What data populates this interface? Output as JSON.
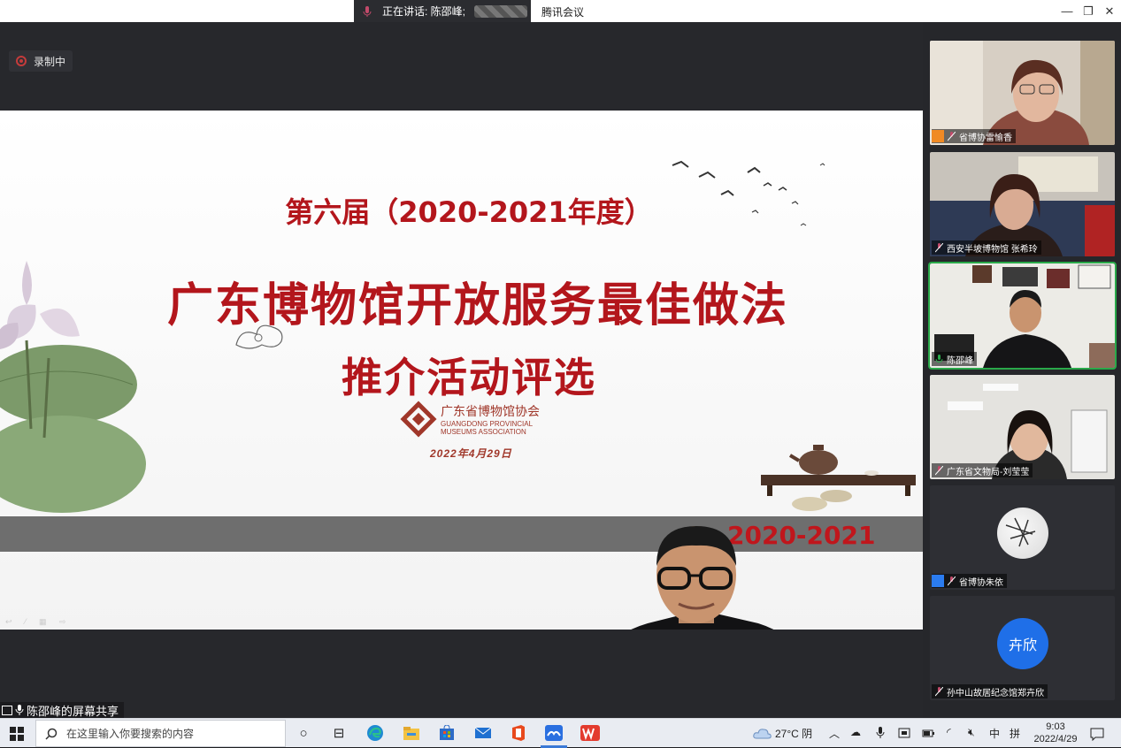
{
  "topbar": {
    "speaking_text": "正在讲话: 陈邵峰;",
    "app_title": "腾讯会议",
    "minimize": "—",
    "restore": "❐",
    "close": "✕"
  },
  "recording": {
    "label": "录制中"
  },
  "slide": {
    "title1": "第六届（2020-2021年度）",
    "title2": "广东博物馆开放服务最佳做法",
    "title3": "推介活动评选",
    "logo_cn": "广东省博物馆协会",
    "logo_en_1": "GUANGDONG PROVINCIAL",
    "logo_en_2": "MUSEUMS ASSOCIATION",
    "date": "2022年4月29日",
    "band_year": "2020-2021",
    "page_controls": "↩ ⁄ ▦ ⇨"
  },
  "share_label": "陈邵峰的屏幕共享",
  "participants": [
    {
      "name": "省博协雷愉香"
    },
    {
      "name": "西安半坡博物馆 张希玲"
    },
    {
      "name": "陈邵峰"
    },
    {
      "name": "广东省文物局-刘莹莹"
    },
    {
      "name": "省博协朱依"
    },
    {
      "name": "孙中山故居纪念馆郑卉欣",
      "avatar_text": "卉欣"
    }
  ],
  "taskbar": {
    "search_placeholder": "在这里输入你要搜索的内容",
    "weather": "27°C 阴",
    "ime": "中",
    "time": "9:03",
    "date": "2022/4/29"
  },
  "colors": {
    "accent_red": "#b3161c",
    "active_speaker": "#2aa94a",
    "avatar_blue": "#1f6fe8"
  }
}
